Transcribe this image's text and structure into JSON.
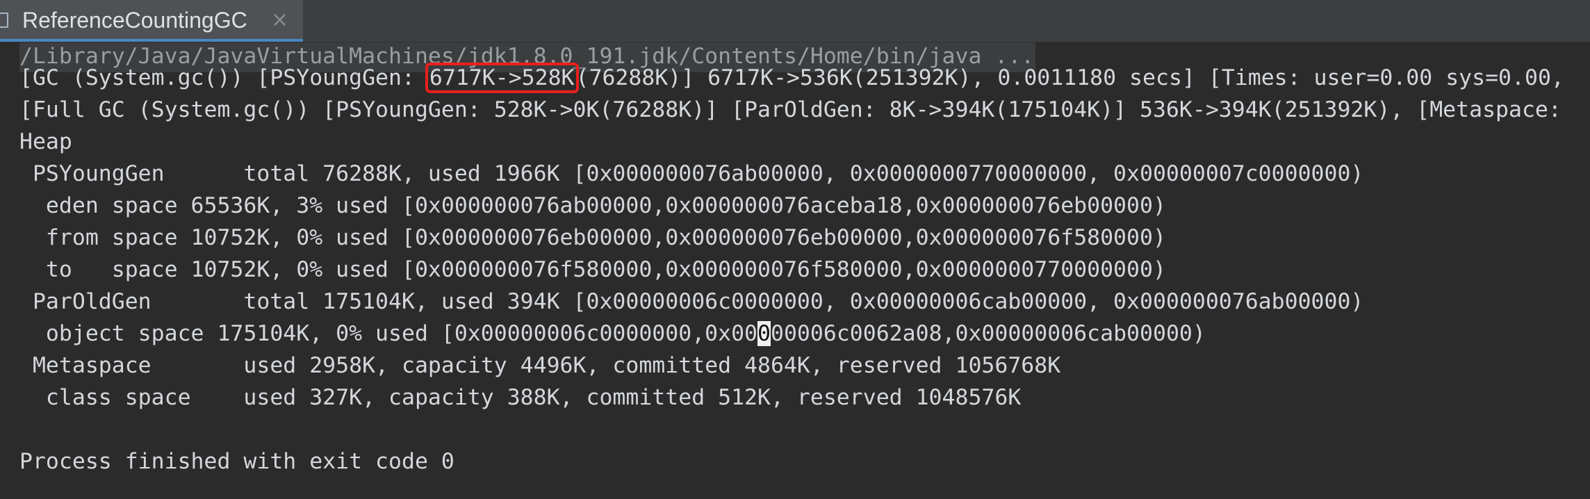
{
  "tab": {
    "title": "ReferenceCountingGC",
    "close_glyph": "×"
  },
  "console": {
    "command": "/Library/Java/JavaVirtualMachines/jdk1.8.0_191.jdk/Contents/Home/bin/java ...",
    "gc_line": {
      "prefix": "[GC (System.gc()) [PSYoungGen: ",
      "highlight": "6717K->528K",
      "suffix": "(76288K)] 6717K->536K(251392K), 0.0011180 secs] [Times: user=0.00 sys=0.00,"
    },
    "full_gc_line": "[Full GC (System.gc()) [PSYoungGen: 528K->0K(76288K)] [ParOldGen: 8K->394K(175104K)] 536K->394K(251392K), [Metaspace:",
    "heap_label": "Heap",
    "psyounggen": " PSYoungGen      total 76288K, used 1966K [0x000000076ab00000, 0x0000000770000000, 0x00000007c0000000)",
    "eden": "  eden space 65536K, 3% used [0x000000076ab00000,0x000000076aceba18,0x000000076eb00000)",
    "from": "  from space 10752K, 0% used [0x000000076eb00000,0x000000076eb00000,0x000000076f580000)",
    "to": "  to   space 10752K, 0% used [0x000000076f580000,0x000000076f580000,0x0000000770000000)",
    "paroldgen": " ParOldGen       total 175104K, used 394K [0x00000006c0000000, 0x00000006cab00000, 0x000000076ab00000)",
    "object_space": {
      "before": "  object space 175104K, 0% used [0x00000006c0000000,0x00",
      "cursor": "0",
      "after": "00006c0062a08,0x00000006cab00000)"
    },
    "metaspace": " Metaspace       used 2958K, capacity 4496K, committed 4864K, reserved 1056768K",
    "class_space": "  class space    used 327K, capacity 388K, committed 512K, reserved 1048576K",
    "exit_message": "Process finished with exit code 0"
  },
  "colors": {
    "background": "#2b2b2b",
    "text": "#d4d7dc",
    "highlight_box": "#e8201c",
    "tab_underline": "#4a88c7"
  }
}
